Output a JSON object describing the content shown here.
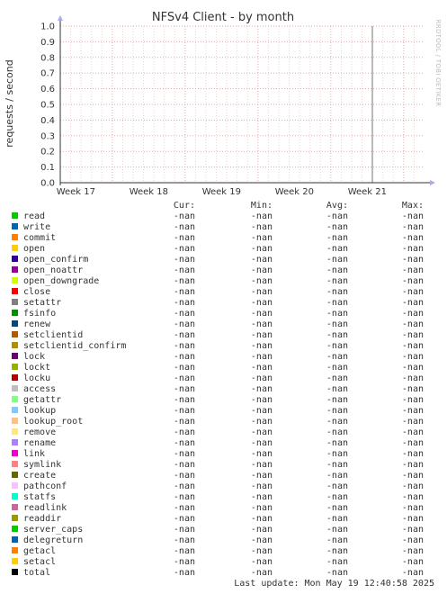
{
  "chart_data": {
    "type": "line",
    "title": "NFSv4 Client - by month",
    "ylabel": "requests / second",
    "watermark": "RRDTOOL / TOBI OETIKER",
    "xlabel": "",
    "x_ticks": [
      "Week 17",
      "Week 18",
      "Week 19",
      "Week 20",
      "Week 21"
    ],
    "y_ticks": [
      "0.0",
      "0.1",
      "0.2",
      "0.3",
      "0.4",
      "0.5",
      "0.6",
      "0.7",
      "0.8",
      "0.9",
      "1.0"
    ],
    "ylim": [
      0,
      1.0
    ],
    "grid": true,
    "legend_placement": "bottom",
    "colors": {
      "major_grid": "#e0a8a8",
      "minor_grid": "#efd2d2",
      "axis": "#333333",
      "marker": "#777777"
    },
    "legend_headers": {
      "cur": "Cur:",
      "min": "Min:",
      "avg": "Avg:",
      "max": "Max:"
    },
    "series": [
      {
        "name": "read",
        "color": "#00cc00",
        "cur": "-nan",
        "min": "-nan",
        "avg": "-nan",
        "max": "-nan"
      },
      {
        "name": "write",
        "color": "#0066b3",
        "cur": "-nan",
        "min": "-nan",
        "avg": "-nan",
        "max": "-nan"
      },
      {
        "name": "commit",
        "color": "#ff8000",
        "cur": "-nan",
        "min": "-nan",
        "avg": "-nan",
        "max": "-nan"
      },
      {
        "name": "open",
        "color": "#ffcc00",
        "cur": "-nan",
        "min": "-nan",
        "avg": "-nan",
        "max": "-nan"
      },
      {
        "name": "open_confirm",
        "color": "#330099",
        "cur": "-nan",
        "min": "-nan",
        "avg": "-nan",
        "max": "-nan"
      },
      {
        "name": "open_noattr",
        "color": "#990099",
        "cur": "-nan",
        "min": "-nan",
        "avg": "-nan",
        "max": "-nan"
      },
      {
        "name": "open_downgrade",
        "color": "#ccff00",
        "cur": "-nan",
        "min": "-nan",
        "avg": "-nan",
        "max": "-nan"
      },
      {
        "name": "close",
        "color": "#ff0000",
        "cur": "-nan",
        "min": "-nan",
        "avg": "-nan",
        "max": "-nan"
      },
      {
        "name": "setattr",
        "color": "#808080",
        "cur": "-nan",
        "min": "-nan",
        "avg": "-nan",
        "max": "-nan"
      },
      {
        "name": "fsinfo",
        "color": "#008f00",
        "cur": "-nan",
        "min": "-nan",
        "avg": "-nan",
        "max": "-nan"
      },
      {
        "name": "renew",
        "color": "#00487d",
        "cur": "-nan",
        "min": "-nan",
        "avg": "-nan",
        "max": "-nan"
      },
      {
        "name": "setclientid",
        "color": "#b35a00",
        "cur": "-nan",
        "min": "-nan",
        "avg": "-nan",
        "max": "-nan"
      },
      {
        "name": "setclientid_confirm",
        "color": "#b38f00",
        "cur": "-nan",
        "min": "-nan",
        "avg": "-nan",
        "max": "-nan"
      },
      {
        "name": "lock",
        "color": "#6b006b",
        "cur": "-nan",
        "min": "-nan",
        "avg": "-nan",
        "max": "-nan"
      },
      {
        "name": "lockt",
        "color": "#8fb300",
        "cur": "-nan",
        "min": "-nan",
        "avg": "-nan",
        "max": "-nan"
      },
      {
        "name": "locku",
        "color": "#b30000",
        "cur": "-nan",
        "min": "-nan",
        "avg": "-nan",
        "max": "-nan"
      },
      {
        "name": "access",
        "color": "#bebebe",
        "cur": "-nan",
        "min": "-nan",
        "avg": "-nan",
        "max": "-nan"
      },
      {
        "name": "getattr",
        "color": "#80ff80",
        "cur": "-nan",
        "min": "-nan",
        "avg": "-nan",
        "max": "-nan"
      },
      {
        "name": "lookup",
        "color": "#80c9ff",
        "cur": "-nan",
        "min": "-nan",
        "avg": "-nan",
        "max": "-nan"
      },
      {
        "name": "lookup_root",
        "color": "#ffc080",
        "cur": "-nan",
        "min": "-nan",
        "avg": "-nan",
        "max": "-nan"
      },
      {
        "name": "remove",
        "color": "#ffe680",
        "cur": "-nan",
        "min": "-nan",
        "avg": "-nan",
        "max": "-nan"
      },
      {
        "name": "rename",
        "color": "#aa80ff",
        "cur": "-nan",
        "min": "-nan",
        "avg": "-nan",
        "max": "-nan"
      },
      {
        "name": "link",
        "color": "#ee00cc",
        "cur": "-nan",
        "min": "-nan",
        "avg": "-nan",
        "max": "-nan"
      },
      {
        "name": "symlink",
        "color": "#ff8080",
        "cur": "-nan",
        "min": "-nan",
        "avg": "-nan",
        "max": "-nan"
      },
      {
        "name": "create",
        "color": "#666600",
        "cur": "-nan",
        "min": "-nan",
        "avg": "-nan",
        "max": "-nan"
      },
      {
        "name": "pathconf",
        "color": "#ffbfff",
        "cur": "-nan",
        "min": "-nan",
        "avg": "-nan",
        "max": "-nan"
      },
      {
        "name": "statfs",
        "color": "#00ffcc",
        "cur": "-nan",
        "min": "-nan",
        "avg": "-nan",
        "max": "-nan"
      },
      {
        "name": "readlink",
        "color": "#cc6699",
        "cur": "-nan",
        "min": "-nan",
        "avg": "-nan",
        "max": "-nan"
      },
      {
        "name": "readdir",
        "color": "#999900",
        "cur": "-nan",
        "min": "-nan",
        "avg": "-nan",
        "max": "-nan"
      },
      {
        "name": "server_caps",
        "color": "#00cc00",
        "cur": "-nan",
        "min": "-nan",
        "avg": "-nan",
        "max": "-nan"
      },
      {
        "name": "delegreturn",
        "color": "#0066b3",
        "cur": "-nan",
        "min": "-nan",
        "avg": "-nan",
        "max": "-nan"
      },
      {
        "name": "getacl",
        "color": "#ff8000",
        "cur": "-nan",
        "min": "-nan",
        "avg": "-nan",
        "max": "-nan"
      },
      {
        "name": "setacl",
        "color": "#ffcc00",
        "cur": "-nan",
        "min": "-nan",
        "avg": "-nan",
        "max": "-nan"
      },
      {
        "name": "total",
        "color": "#000000",
        "cur": "-nan",
        "min": "-nan",
        "avg": "-nan",
        "max": "-nan"
      }
    ],
    "last_update": "Last update: Mon May 19 12:40:58 2025"
  }
}
